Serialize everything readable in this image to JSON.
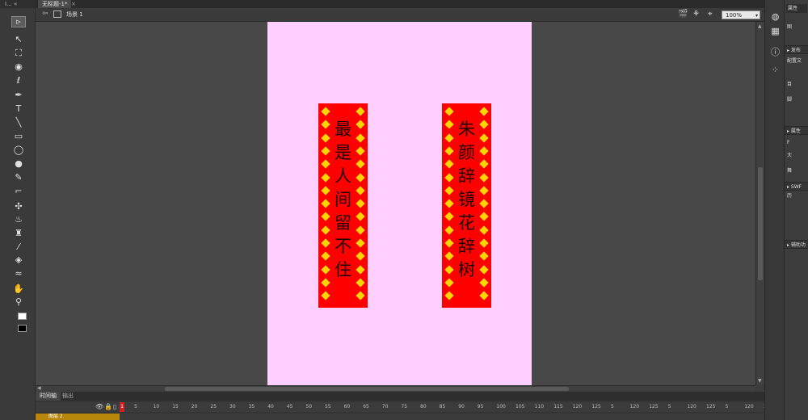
{
  "tabs": {
    "document_tab": "无标题-1*",
    "close_glyph": "×",
    "left_grip": "I...  «"
  },
  "scene": {
    "label": "场景 1",
    "back_glyph": "⇦",
    "zoom_value": "100%",
    "zoom_arrow": "▾"
  },
  "stage": {
    "background": "#ffd0ff",
    "couplets": [
      {
        "text": "最是人间留不住",
        "chars": [
          "最",
          "是",
          "人",
          "间",
          "留",
          "不",
          "住"
        ]
      },
      {
        "text": "朱颜辞镜花辞树",
        "chars": [
          "朱",
          "颜",
          "辞",
          "镜",
          "花",
          "辞",
          "树"
        ]
      }
    ],
    "couplet_color": "#fe0000",
    "diamond_color": "#ffd400"
  },
  "tools": [
    {
      "name": "selection-tool-icon",
      "glyph": "▹"
    },
    {
      "name": "subselection-tool-icon",
      "glyph": "↖"
    },
    {
      "name": "free-transform-tool-icon",
      "glyph": "⛶"
    },
    {
      "name": "3d-rotation-tool-icon",
      "glyph": "◉"
    },
    {
      "name": "lasso-tool-icon",
      "glyph": "ℓ"
    },
    {
      "name": "pen-tool-icon",
      "glyph": "✒"
    },
    {
      "name": "text-tool-icon",
      "glyph": "T"
    },
    {
      "name": "line-tool-icon",
      "glyph": "╲"
    },
    {
      "name": "rectangle-tool-icon",
      "glyph": "▭"
    },
    {
      "name": "oval-tool-icon",
      "glyph": "◯"
    },
    {
      "name": "polystar-tool-icon",
      "glyph": "●"
    },
    {
      "name": "pencil-tool-icon",
      "glyph": "✎"
    },
    {
      "name": "brush-tool-icon",
      "glyph": "⌐"
    },
    {
      "name": "bone-tool-icon",
      "glyph": "✣"
    },
    {
      "name": "paint-bucket-tool-icon",
      "glyph": "♨"
    },
    {
      "name": "ink-bottle-tool-icon",
      "glyph": "♜"
    },
    {
      "name": "eyedropper-tool-icon",
      "glyph": "⁄"
    },
    {
      "name": "eraser-tool-icon",
      "glyph": "◈"
    },
    {
      "name": "width-tool-icon",
      "glyph": "≈"
    },
    {
      "name": "hand-tool-icon",
      "glyph": "✋"
    },
    {
      "name": "zoom-tool-icon",
      "glyph": "⚲"
    }
  ],
  "timeline": {
    "tab_timeline": "时间轴",
    "tab_output": "输出",
    "frame_numbers": [
      "1",
      "5",
      "10",
      "15",
      "20",
      "25",
      "30",
      "35",
      "40",
      "45",
      "50",
      "55",
      "60",
      "65",
      "70",
      "75",
      "80",
      "85",
      "90",
      "95",
      "100",
      "105",
      "110",
      "115",
      "120",
      "125",
      "5",
      "120",
      "125",
      "5",
      "120",
      "125",
      "5",
      "120",
      "125"
    ],
    "layer_name": "图层 2"
  },
  "right_panel": {
    "tab": "属性",
    "rows": [
      {
        "label": "图",
        "header": false
      },
      {
        "label": "发布",
        "header": true
      },
      {
        "label": "配置文",
        "header": false
      },
      {
        "label": "目",
        "header": false
      },
      {
        "label": "脚",
        "header": false
      },
      {
        "label": "属性",
        "header": true
      },
      {
        "label": "F",
        "header": false
      },
      {
        "label": "大",
        "header": false
      },
      {
        "label": "舞",
        "header": false
      },
      {
        "label": "SWF 历",
        "header": true
      },
      {
        "label": "辅助功",
        "header": true
      }
    ]
  }
}
